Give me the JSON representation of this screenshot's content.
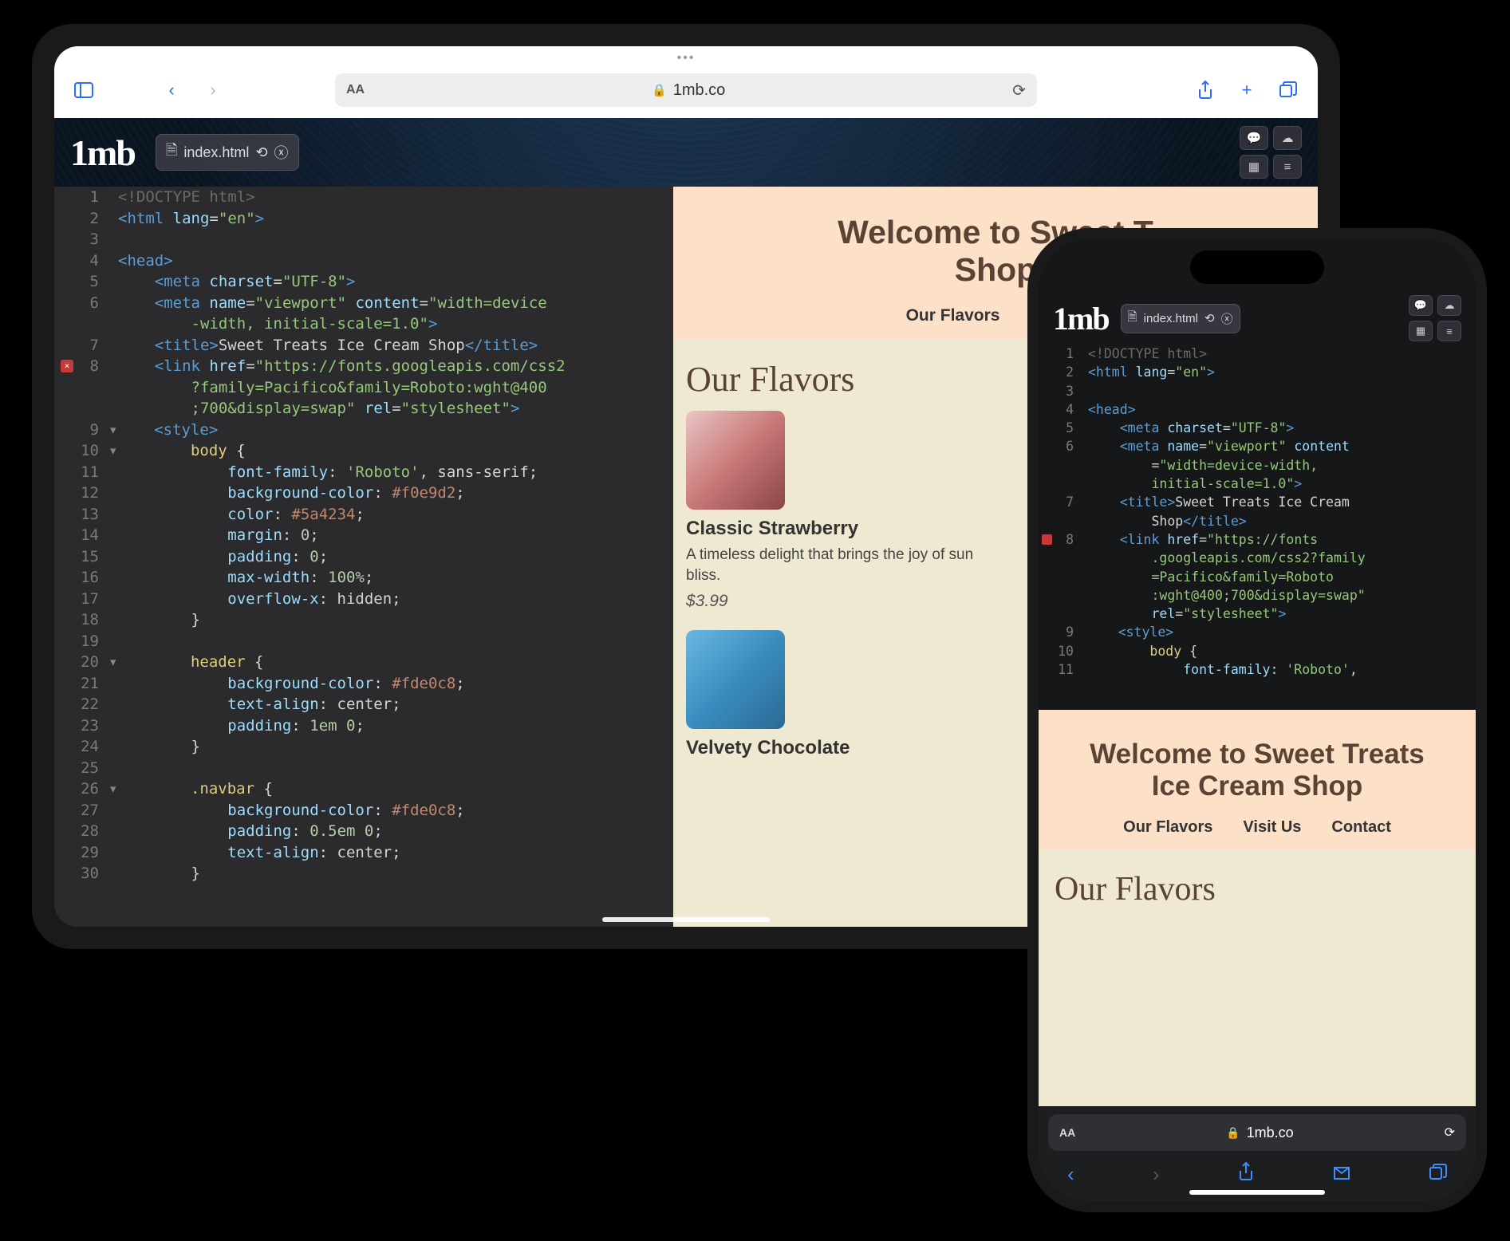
{
  "ipad": {
    "url_domain": "1mb.co",
    "logo": "1mb",
    "file_tab": "index.html",
    "code": {
      "error_line": 8,
      "lines": [
        {
          "n": 1,
          "html": "<span class='c-com'>&lt;!DOCTYPE html&gt;</span>"
        },
        {
          "n": 2,
          "html": "<span class='c-tag'>&lt;html</span> <span class='c-attr'>lang</span>=<span class='c-str'>\"en\"</span><span class='c-tag'>&gt;</span>"
        },
        {
          "n": 3,
          "html": ""
        },
        {
          "n": 4,
          "html": "<span class='c-tag'>&lt;head&gt;</span>"
        },
        {
          "n": 5,
          "html": "    <span class='c-tag'>&lt;meta</span> <span class='c-attr'>charset</span>=<span class='c-str'>\"UTF-8\"</span><span class='c-tag'>&gt;</span>"
        },
        {
          "n": 6,
          "html": "    <span class='c-tag'>&lt;meta</span> <span class='c-attr'>name</span>=<span class='c-str'>\"viewport\"</span> <span class='c-attr'>content</span>=<span class='c-str'>\"width=device</span>"
        },
        {
          "n": "",
          "html": "        <span class='c-str'>-width, initial-scale=1.0\"</span><span class='c-tag'>&gt;</span>"
        },
        {
          "n": 7,
          "html": "    <span class='c-tag'>&lt;title&gt;</span>Sweet Treats Ice Cream Shop<span class='c-tag'>&lt;/title&gt;</span>"
        },
        {
          "n": 8,
          "html": "    <span class='c-tag'>&lt;link</span> <span class='c-attr'>href</span>=<span class='c-str'>\"https://fonts.googleapis.com/css2</span>"
        },
        {
          "n": "",
          "html": "        <span class='c-str'>?family=Pacifico&amp;family=Roboto:wght@400</span>"
        },
        {
          "n": "",
          "html": "        <span class='c-str'>;700&amp;display=swap\"</span> <span class='c-attr'>rel</span>=<span class='c-str'>\"stylesheet\"</span><span class='c-tag'>&gt;</span>"
        },
        {
          "n": 9,
          "fold": "▾",
          "html": "    <span class='c-tag'>&lt;style&gt;</span>"
        },
        {
          "n": 10,
          "fold": "▾",
          "html": "        <span class='c-sel'>body</span> {"
        },
        {
          "n": 11,
          "html": "            <span class='c-prop'>font-family</span>: <span class='c-str'>'Roboto'</span>, sans-serif;"
        },
        {
          "n": 12,
          "html": "            <span class='c-prop'>background-color</span>: <span class='c-val'>#f0e9d2</span>;"
        },
        {
          "n": 13,
          "html": "            <span class='c-prop'>color</span>: <span class='c-val'>#5a4234</span>;"
        },
        {
          "n": 14,
          "html": "            <span class='c-prop'>margin</span>: <span class='c-num'>0</span>;"
        },
        {
          "n": 15,
          "html": "            <span class='c-prop'>padding</span>: <span class='c-num'>0</span>;"
        },
        {
          "n": 16,
          "html": "            <span class='c-prop'>max-width</span>: <span class='c-num'>100%</span>;"
        },
        {
          "n": 17,
          "html": "            <span class='c-prop'>overflow-x</span>: hidden;"
        },
        {
          "n": 18,
          "html": "        }"
        },
        {
          "n": 19,
          "html": ""
        },
        {
          "n": 20,
          "fold": "▾",
          "html": "        <span class='c-sel'>header</span> {"
        },
        {
          "n": 21,
          "html": "            <span class='c-prop'>background-color</span>: <span class='c-val'>#fde0c8</span>;"
        },
        {
          "n": 22,
          "html": "            <span class='c-prop'>text-align</span>: center;"
        },
        {
          "n": 23,
          "html": "            <span class='c-prop'>padding</span>: <span class='c-num'>1em</span> <span class='c-num'>0</span>;"
        },
        {
          "n": 24,
          "html": "        }"
        },
        {
          "n": 25,
          "html": ""
        },
        {
          "n": 26,
          "fold": "▾",
          "html": "        <span class='c-sel'>.navbar</span> {"
        },
        {
          "n": 27,
          "html": "            <span class='c-prop'>background-color</span>: <span class='c-val'>#fde0c8</span>;"
        },
        {
          "n": 28,
          "html": "            <span class='c-prop'>padding</span>: <span class='c-num'>0.5em</span> <span class='c-num'>0</span>;"
        },
        {
          "n": 29,
          "html": "            <span class='c-prop'>text-align</span>: center;"
        },
        {
          "n": 30,
          "html": "        }"
        }
      ]
    },
    "preview": {
      "heading_line1": "Welcome to Sweet T",
      "heading_line2": "Shop",
      "nav": [
        "Our Flavors",
        "Visit U"
      ],
      "section_title": "Our Flavors",
      "flavors": [
        {
          "name": "Classic Strawberry",
          "desc": "A timeless delight that brings the joy of sun",
          "desc2": "bliss.",
          "price": "$3.99"
        },
        {
          "name": "Velvety Chocolate",
          "desc": "",
          "desc2": "",
          "price": ""
        }
      ]
    }
  },
  "iphone": {
    "url_domain": "1mb.co",
    "logo": "1mb",
    "file_tab": "index.html",
    "code": {
      "error_line": 8,
      "lines": [
        {
          "n": 1,
          "html": "<span class='c-com'>&lt;!DOCTYPE html&gt;</span>"
        },
        {
          "n": 2,
          "html": "<span class='c-tag'>&lt;html</span> <span class='c-attr'>lang</span>=<span class='c-str'>\"en\"</span><span class='c-tag'>&gt;</span>"
        },
        {
          "n": 3,
          "html": ""
        },
        {
          "n": 4,
          "html": "<span class='c-tag'>&lt;head&gt;</span>"
        },
        {
          "n": 5,
          "html": "    <span class='c-tag'>&lt;meta</span> <span class='c-attr'>charset</span>=<span class='c-str'>\"UTF-8\"</span><span class='c-tag'>&gt;</span>"
        },
        {
          "n": 6,
          "html": "    <span class='c-tag'>&lt;meta</span> <span class='c-attr'>name</span>=<span class='c-str'>\"viewport\"</span> <span class='c-attr'>content</span>"
        },
        {
          "n": "",
          "html": "        =<span class='c-str'>\"width=device-width,</span>"
        },
        {
          "n": "",
          "html": "        <span class='c-str'>initial-scale=1.0\"</span><span class='c-tag'>&gt;</span>"
        },
        {
          "n": 7,
          "html": "    <span class='c-tag'>&lt;title&gt;</span>Sweet Treats Ice Cream"
        },
        {
          "n": "",
          "html": "        Shop<span class='c-tag'>&lt;/title&gt;</span>"
        },
        {
          "n": 8,
          "html": "    <span class='c-tag'>&lt;link</span> <span class='c-attr'>href</span>=<span class='c-str'>\"https://fonts</span>"
        },
        {
          "n": "",
          "html": "        <span class='c-str'>.googleapis.com/css2?family</span>"
        },
        {
          "n": "",
          "html": "        <span class='c-str'>=Pacifico&amp;family=Roboto</span>"
        },
        {
          "n": "",
          "html": "        <span class='c-str'>:wght@400;700&amp;display=swap\"</span>"
        },
        {
          "n": "",
          "html": "        <span class='c-attr'>rel</span>=<span class='c-str'>\"stylesheet\"</span><span class='c-tag'>&gt;</span>"
        },
        {
          "n": 9,
          "fold": "▾",
          "html": "    <span class='c-tag'>&lt;style&gt;</span>"
        },
        {
          "n": 10,
          "fold": "▾",
          "html": "        <span class='c-sel'>body</span> {"
        },
        {
          "n": 11,
          "html": "            <span class='c-prop'>font-family</span>: <span class='c-str'>'Roboto'</span>,"
        }
      ]
    },
    "preview": {
      "heading_line1": "Welcome to Sweet Treats",
      "heading_line2": "Ice Cream Shop",
      "nav": [
        "Our Flavors",
        "Visit Us",
        "Contact"
      ],
      "section_title": "Our Flavors"
    }
  }
}
